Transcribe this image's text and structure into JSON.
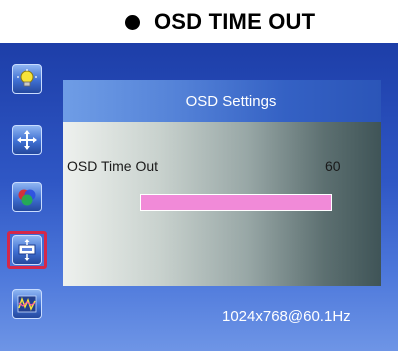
{
  "heading": {
    "bullet_icon": "filled-circle-bullet",
    "title": "OSD TIME OUT"
  },
  "sidebar": {
    "items": [
      {
        "icon": "brightness-bulb-icon"
      },
      {
        "icon": "position-arrows-icon"
      },
      {
        "icon": "color-rgb-icon"
      },
      {
        "icon": "osd-settings-icon",
        "selected": true
      },
      {
        "icon": "signal-waveform-icon"
      }
    ]
  },
  "panel": {
    "title": "OSD Settings",
    "row": {
      "label": "OSD Time Out",
      "value": "60",
      "level_fraction": 1.0
    }
  },
  "status": {
    "resolution": "1024x768@60.1Hz"
  },
  "colors": {
    "osd_background": "#2f57c5",
    "slider_fill": "#f18ad8",
    "selection_frame": "#d4284a"
  }
}
